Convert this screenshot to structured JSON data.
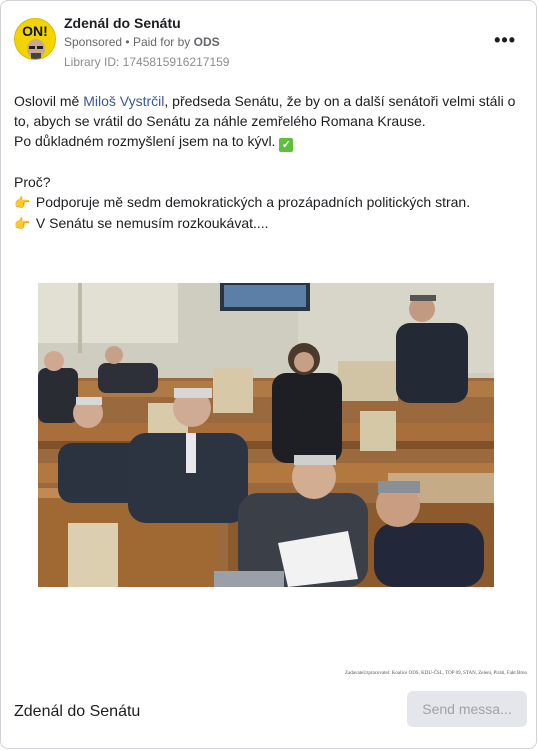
{
  "header": {
    "page_name": "Zdenál do Senátu",
    "sponsored": "Sponsored",
    "paid_for_by_prefix": "Paid for by",
    "sponsor_name": "ODS",
    "library_id": "Library ID: 1745815916217159",
    "more_icon": "more-horizontal-icon",
    "avatar_text": "ON!"
  },
  "post": {
    "line1_before": "Oslovil mě ",
    "line1_link": "Miloš Vystrčil",
    "line1_after": ", předseda Senátu, že by on a další senátoři velmi stáli o to, abych se vrátil do Senátu za náhle zemřelého Romana Krause.",
    "line2": "Po důkladném rozmyšlení jsem na to kývl. ",
    "check_emoji": "✓",
    "why": "Proč?",
    "bullet1": " Podporuje mě sedm demokratických a prozápadních politických stran.",
    "bullet2": " V Senátu se nemusím rozkoukávat....",
    "hand_emoji": "👉"
  },
  "image": {
    "credit": "Zadavatel/zpracovatel: Koalice ODS, KDU-ČSL, TOP 09, STAN, Zelení, Piráti, Fakt Brno"
  },
  "footer": {
    "title": "Zdenál do Senátu",
    "send_button": "Send messa..."
  },
  "colors": {
    "link": "#385898",
    "avatar_bg": "#f4d400",
    "button_bg": "#e4e6eb"
  }
}
